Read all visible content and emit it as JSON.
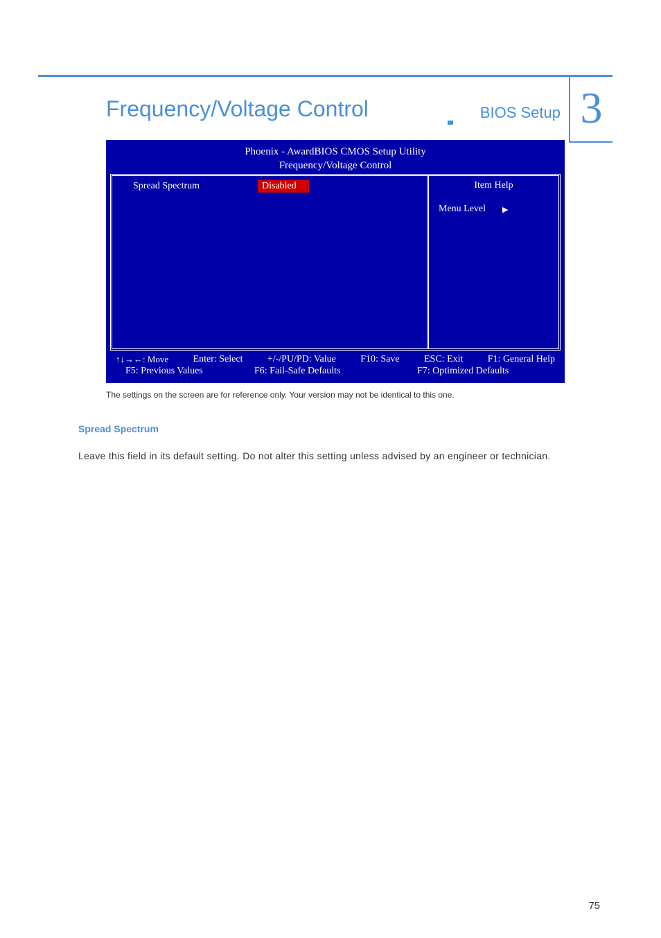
{
  "header": {
    "section_label": "BIOS Setup",
    "chapter_number": "3"
  },
  "page": {
    "title": "Frequency/Voltage Control",
    "number": "75"
  },
  "bios": {
    "title_line1": "Phoenix - AwardBIOS CMOS Setup Utility",
    "title_line2": "Frequency/Voltage Control",
    "row_label": "Spread Spectrum",
    "row_value": "Disabled",
    "help_title": "Item Help",
    "menu_level_label": "Menu Level",
    "footer": {
      "move": "↑↓→←: Move",
      "enter": "Enter: Select",
      "value": "+/-/PU/PD: Value",
      "save": "F10: Save",
      "exit": "ESC: Exit",
      "help": "F1: General Help",
      "f5": "F5: Previous Values",
      "f6": "F6: Fail-Safe Defaults",
      "f7": "F7: Optimized Defaults"
    }
  },
  "caption": "The settings on the screen are for reference only. Your version may not be identical to this one.",
  "subsection": {
    "heading": "Spread Spectrum",
    "body": "Leave this field in its default setting. Do not alter this setting unless advised by an engineer or technician."
  }
}
